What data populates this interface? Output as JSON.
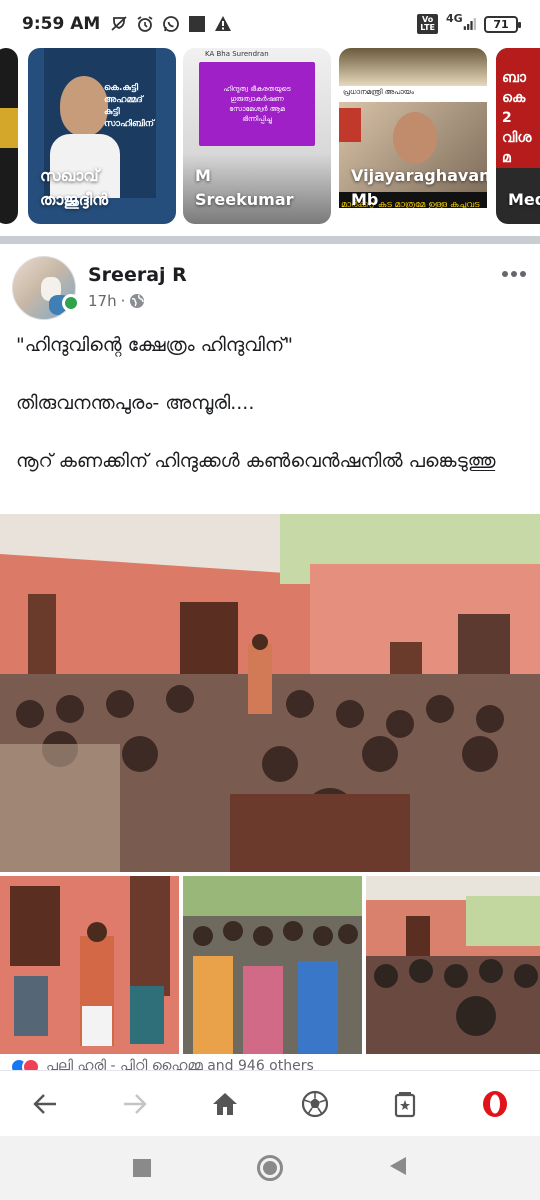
{
  "status_bar": {
    "time": "9:59 AM",
    "volte_label": "Vo\nLTE",
    "network": "4G",
    "battery": "71",
    "icons": [
      "mute-icon",
      "alarm-icon",
      "whatsapp-icon",
      "notification-square-icon",
      "warning-icon",
      "signal-icon"
    ]
  },
  "stories": [
    {
      "name": "",
      "text": "",
      "accent": "#1b1b1b"
    },
    {
      "name": "സഖാവ്\nതാജുദ്ദീൻ",
      "text": "കെ.കുട്ടി\nഅഹമ്മദ് കുട്ടി\nസാഹിബിന്",
      "accent": "#1f4c7a"
    },
    {
      "name": "M\nSreekumar",
      "text": "ഹിന്ദുത്വ ഭീകരതയുടെ ഗുരുത്വാകർഷണ\nസോമേശ്വർ ആമ\nഭിന്നിപ്പിച്ചു",
      "header": "KA Bha Surendran",
      "accent": "#9c27b0"
    },
    {
      "name": "Vijayaraghavan\nMb",
      "text": "പ്രധാനമന്ത്രി അപായം",
      "ticker": "മാർക്കറ്റ് കട മാത്രമേ ഉള്ളൂ കച്ചവട",
      "accent": "#c62828"
    },
    {
      "name": "Med",
      "text": "ബാ\nകെ\n2\nവിശ\nമ",
      "accent": "#b71c1c"
    }
  ],
  "post": {
    "author": "Sreeraj R",
    "time": "17h",
    "privacy_icon": "globe-icon",
    "text": [
      "\"ഹിന്ദുവിന്റെ ക്ഷേത്രം ഹിന്ദുവിന്\"",
      "തിരുവനന്തപുരം- അമ്പൂരി....",
      "നൂറ് കണക്കിന് ഹിന്ദുക്കൾ കൺവെൻഷനിൽ പങ്കെടുത്തു"
    ],
    "reactions_text": "പലി ഹരി - പിറ്റി ഹൈമ്മ and 946 others"
  },
  "browser_nav": {
    "buttons": [
      "back-arrow-icon",
      "forward-arrow-icon",
      "home-icon",
      "football-icon",
      "tabs-icon",
      "opera-icon"
    ]
  },
  "system_nav": {
    "buttons": [
      "recents-square-icon",
      "home-circle-icon",
      "back-triangle-icon"
    ]
  },
  "colors": {
    "fb_blue": "#1877f2",
    "opera_red": "#e0131b",
    "online_green": "#31a24c",
    "wall_pink": "#d9826e"
  }
}
